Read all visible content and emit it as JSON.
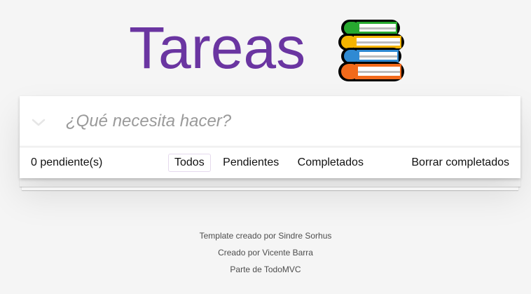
{
  "header": {
    "title": "Tareas",
    "icon": "books-icon"
  },
  "new_todo": {
    "placeholder": "¿Qué necesita hacer?",
    "value": ""
  },
  "footer": {
    "count_text": "0 pendiente(s)",
    "filters": [
      {
        "label": "Todos",
        "selected": true
      },
      {
        "label": "Pendientes",
        "selected": false
      },
      {
        "label": "Completados",
        "selected": false
      }
    ],
    "clear_label": "Borrar completados"
  },
  "info": {
    "line1": "Template creado por Sindre Sorhus",
    "line2": "Creado por Vicente Barra",
    "line3": "Parte de TodoMVC"
  },
  "colors": {
    "title": "#6a35a1",
    "background": "#f5f5f5",
    "selected_filter_border": "#e5d9ed"
  }
}
